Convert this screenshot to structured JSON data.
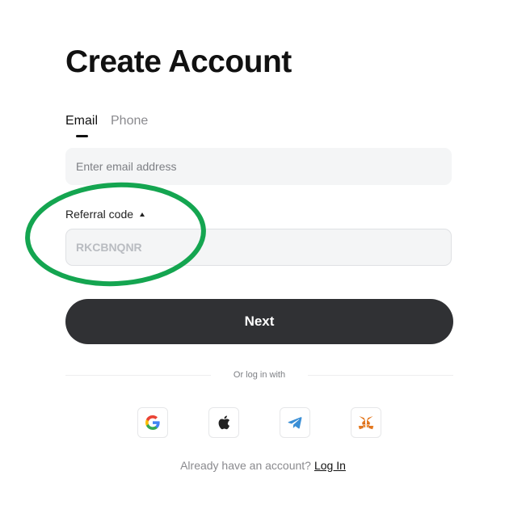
{
  "page": {
    "title": "Create Account"
  },
  "tabs": [
    {
      "label": "Email",
      "active": true
    },
    {
      "label": "Phone",
      "active": false
    }
  ],
  "email": {
    "value": "",
    "placeholder": "Enter email address"
  },
  "referral": {
    "label": "Referral code",
    "value": "",
    "placeholder": "RKCBNQNR"
  },
  "next_button": {
    "label": "Next"
  },
  "divider": {
    "text": "Or log in with"
  },
  "social_logins": [
    {
      "icon": "google-icon"
    },
    {
      "icon": "apple-icon"
    },
    {
      "icon": "telegram-icon"
    },
    {
      "icon": "metamask-icon"
    }
  ],
  "footer": {
    "prompt": "Already have an account?",
    "link": "Log In"
  },
  "colors": {
    "annotation_circle": "#14a550",
    "button_background": "#303134",
    "input_background": "#f4f5f6"
  }
}
